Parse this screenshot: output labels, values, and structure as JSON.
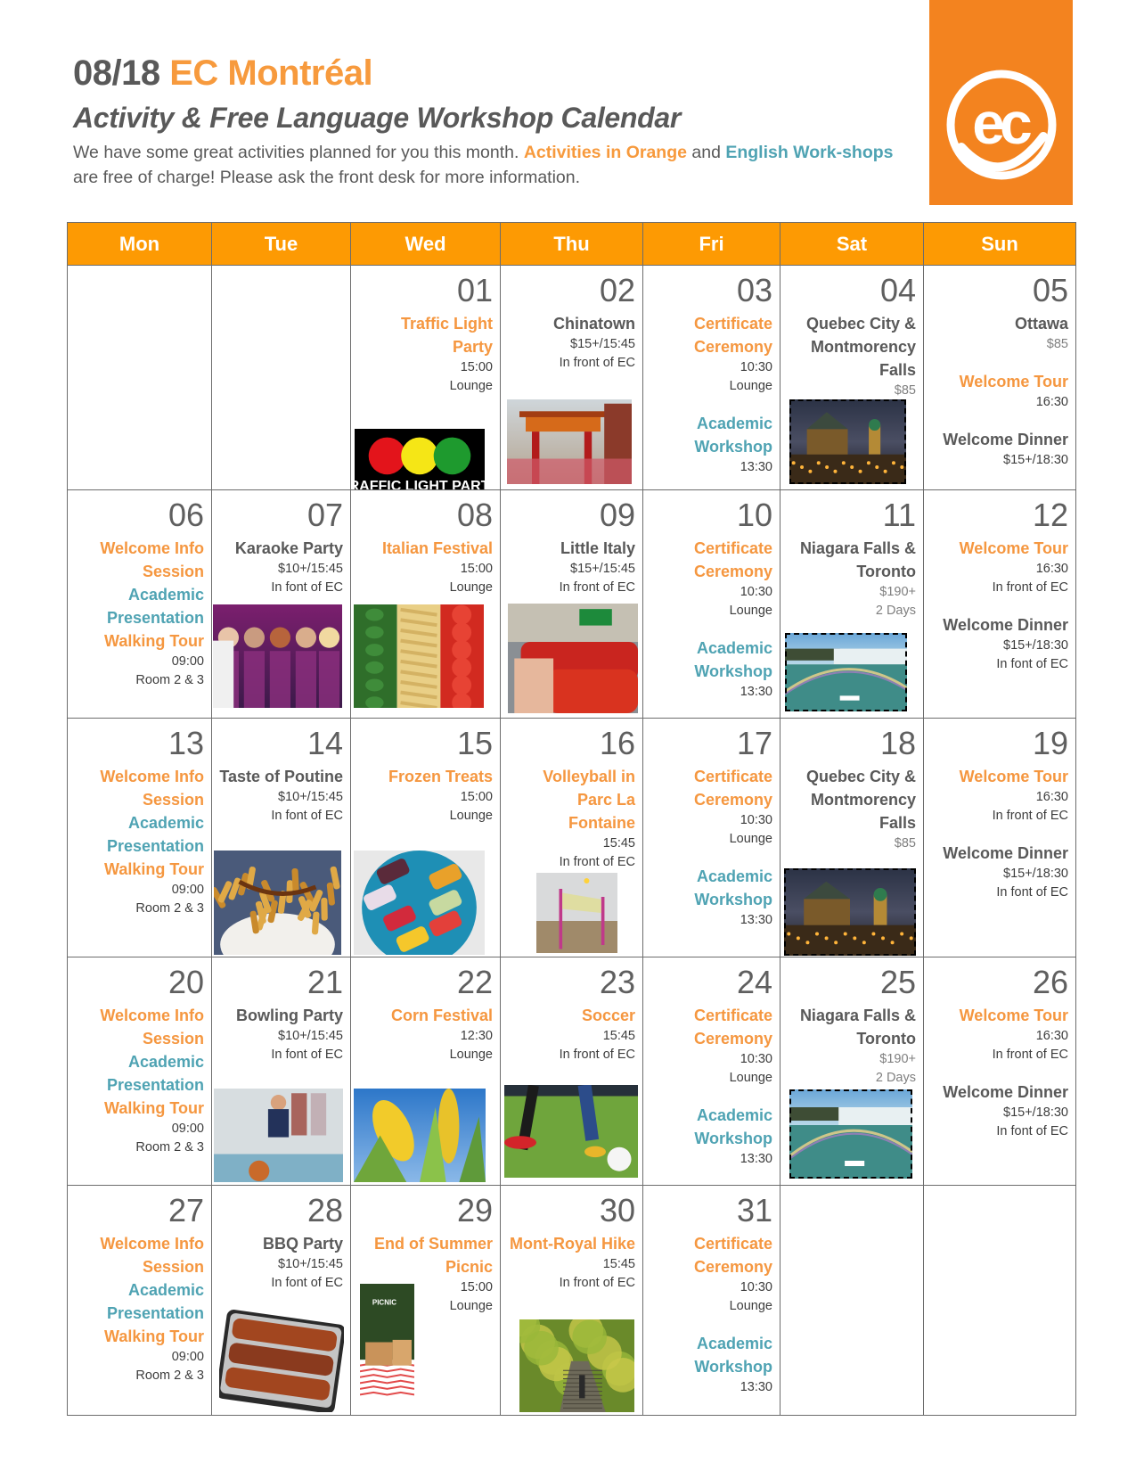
{
  "header": {
    "month": "08/18",
    "school": "EC Montréal",
    "subtitle": "Activity & Free Language Workshop Calendar",
    "intro_part1": "We have some great activities planned for you this month. ",
    "intro_orange": "Activities in Orange",
    "intro_and": " and ",
    "intro_teal": "English Work-shops",
    "intro_part2": " are free  of charge!  Please ask the front desk for more information."
  },
  "logo": {
    "text": "ec",
    "background": "#f3831f"
  },
  "colors": {
    "orange": "#f59740",
    "teal": "#4fa3b3",
    "header": "#fd9a03",
    "gray": "#595959"
  },
  "weekdays": [
    "Mon",
    "Tue",
    "Wed",
    "Thu",
    "Fri",
    "Sat",
    "Sun"
  ],
  "weeks": [
    [
      {
        "day": ""
      },
      {
        "day": ""
      },
      {
        "day": "01",
        "events": [
          {
            "title": "Traffic Light Party",
            "color": "orange",
            "details": [
              "15:00",
              "Lounge"
            ]
          }
        ],
        "image": "traffic-light-party"
      },
      {
        "day": "02",
        "events": [
          {
            "title": "Chinatown",
            "color": "gray",
            "details": [
              "$15+/15:45",
              "In front of EC"
            ]
          }
        ],
        "image": "chinatown-gate"
      },
      {
        "day": "03",
        "events": [
          {
            "title": "Certificate Ceremony",
            "color": "orange",
            "details": [
              "10:30",
              "Lounge"
            ]
          },
          {
            "title": "Academic Workshop",
            "color": "teal",
            "details": [
              "13:30"
            ]
          }
        ]
      },
      {
        "day": "04",
        "events": [
          {
            "title": "Quebec City & Montmorency Falls",
            "color": "gray",
            "details": [
              "$85"
            ]
          }
        ],
        "image": "quebec-city-night"
      },
      {
        "day": "05",
        "events": [
          {
            "title": "Ottawa",
            "color": "gray",
            "details": [
              "$85"
            ]
          },
          {
            "title": "Welcome Tour",
            "color": "orange",
            "details": [
              "16:30"
            ]
          },
          {
            "title": "Welcome Dinner",
            "color": "gray",
            "details": [
              "$15+/18:30"
            ]
          }
        ]
      }
    ],
    [
      {
        "day": "06",
        "events": [
          {
            "title": "Welcome Info Session",
            "color": "orange"
          },
          {
            "title": "Academic Presentation",
            "color": "teal"
          },
          {
            "title": "Walking Tour",
            "color": "orange",
            "details": [
              "09:00",
              "Room 2 & 3"
            ]
          }
        ]
      },
      {
        "day": "07",
        "events": [
          {
            "title": "Karaoke Party",
            "color": "gray",
            "details": [
              "$10+/15:45",
              "In font of EC"
            ]
          }
        ],
        "image": "karaoke-party"
      },
      {
        "day": "08",
        "events": [
          {
            "title": "Italian Festival",
            "color": "orange",
            "details": [
              "15:00",
              "Lounge"
            ]
          }
        ],
        "image": "italian-flag-food"
      },
      {
        "day": "09",
        "events": [
          {
            "title": "Little Italy",
            "color": "gray",
            "details": [
              "$15+/15:45",
              "In front of EC"
            ]
          }
        ],
        "image": "little-italy-cars"
      },
      {
        "day": "10",
        "events": [
          {
            "title": "Certificate Ceremony",
            "color": "orange",
            "details": [
              "10:30",
              "Lounge"
            ]
          },
          {
            "title": "Academic Workshop",
            "color": "teal",
            "details": [
              "13:30"
            ]
          }
        ]
      },
      {
        "day": "11",
        "events": [
          {
            "title": "Niagara Falls & Toronto",
            "color": "gray",
            "details": [
              "$190+",
              "2 Days"
            ]
          }
        ],
        "image": "niagara-falls"
      },
      {
        "day": "12",
        "events": [
          {
            "title": "Welcome Tour",
            "color": "orange",
            "details": [
              "16:30",
              "In front of EC"
            ]
          },
          {
            "title": "Welcome Dinner",
            "color": "gray",
            "details": [
              "$15+/18:30",
              "In font of EC"
            ]
          }
        ]
      }
    ],
    [
      {
        "day": "13",
        "events": [
          {
            "title": "Welcome Info Session",
            "color": "orange"
          },
          {
            "title": "Academic Presentation",
            "color": "teal"
          },
          {
            "title": "Walking Tour",
            "color": "orange",
            "details": [
              "09:00",
              "Room 2 & 3"
            ]
          }
        ]
      },
      {
        "day": "14",
        "events": [
          {
            "title": "Taste of Poutine",
            "color": "gray",
            "details": [
              "$10+/15:45",
              "In font of EC"
            ]
          }
        ],
        "image": "poutine"
      },
      {
        "day": "15",
        "events": [
          {
            "title": "Frozen Treats",
            "color": "orange",
            "details": [
              "15:00",
              "Lounge"
            ]
          }
        ],
        "image": "popsicles"
      },
      {
        "day": "16",
        "events": [
          {
            "title": "Volleyball in Parc La Fontaine",
            "color": "orange",
            "details": [
              "15:45",
              "In front of EC"
            ]
          }
        ],
        "image": "beach-volleyball"
      },
      {
        "day": "17",
        "events": [
          {
            "title": "Certificate Ceremony",
            "color": "orange",
            "details": [
              "10:30",
              "Lounge"
            ]
          },
          {
            "title": "Academic Workshop",
            "color": "teal",
            "details": [
              "13:30"
            ]
          }
        ]
      },
      {
        "day": "18",
        "events": [
          {
            "title": "Quebec City & Montmorency Falls",
            "color": "gray",
            "details": [
              "$85"
            ]
          }
        ],
        "image": "quebec-city-night"
      },
      {
        "day": "19",
        "events": [
          {
            "title": "Welcome Tour",
            "color": "orange",
            "details": [
              "16:30",
              "In front of EC"
            ]
          },
          {
            "title": "Welcome Dinner",
            "color": "gray",
            "details": [
              "$15+/18:30",
              "In font of EC"
            ]
          }
        ]
      }
    ],
    [
      {
        "day": "20",
        "events": [
          {
            "title": "Welcome Info Session",
            "color": "orange"
          },
          {
            "title": "Academic Presentation",
            "color": "teal"
          },
          {
            "title": "Walking Tour",
            "color": "orange",
            "details": [
              "09:00",
              "Room 2 & 3"
            ]
          }
        ]
      },
      {
        "day": "21",
        "events": [
          {
            "title": "Bowling Party",
            "color": "gray",
            "details": [
              "$10+/15:45",
              "In font of EC"
            ]
          }
        ],
        "image": "bowling"
      },
      {
        "day": "22",
        "events": [
          {
            "title": "Corn Festival",
            "color": "orange",
            "details": [
              "12:30",
              "Lounge"
            ]
          }
        ],
        "image": "corn"
      },
      {
        "day": "23",
        "events": [
          {
            "title": "Soccer",
            "color": "orange",
            "details": [
              "15:45",
              "In front of EC"
            ]
          }
        ],
        "image": "soccer"
      },
      {
        "day": "24",
        "events": [
          {
            "title": "Certificate Ceremony",
            "color": "orange",
            "details": [
              "10:30",
              "Lounge"
            ]
          },
          {
            "title": "Academic Workshop",
            "color": "teal",
            "details": [
              "13:30"
            ]
          }
        ]
      },
      {
        "day": "25",
        "events": [
          {
            "title": "Niagara Falls & Toronto",
            "color": "gray",
            "details": [
              "$190+",
              "2 Days"
            ]
          }
        ],
        "image": "niagara-falls"
      },
      {
        "day": "26",
        "events": [
          {
            "title": "Welcome Tour",
            "color": "orange",
            "details": [
              "16:30",
              "In front of EC"
            ]
          },
          {
            "title": "Welcome Dinner",
            "color": "gray",
            "details": [
              "$15+/18:30",
              "In font of EC"
            ]
          }
        ]
      }
    ],
    [
      {
        "day": "27",
        "events": [
          {
            "title": "Welcome Info Session",
            "color": "orange"
          },
          {
            "title": "Academic Presentation",
            "color": "teal"
          },
          {
            "title": "Walking Tour",
            "color": "orange",
            "details": [
              "09:00",
              "Room 2 & 3"
            ]
          }
        ]
      },
      {
        "day": "28",
        "events": [
          {
            "title": "BBQ Party",
            "color": "gray",
            "details": [
              "$10+/15:45",
              "In font of EC"
            ]
          }
        ],
        "image": "bbq-ribs"
      },
      {
        "day": "29",
        "events": [
          {
            "title": "End of Summer Picnic",
            "color": "orange",
            "details": [
              "15:00",
              "Lounge"
            ]
          }
        ],
        "image": "picnic"
      },
      {
        "day": "30",
        "events": [
          {
            "title": "Mont-Royal Hike",
            "color": "orange",
            "details": [
              "15:45",
              "In front of EC"
            ]
          }
        ],
        "image": "mont-royal-stairs"
      },
      {
        "day": "31",
        "events": [
          {
            "title": "Certificate Ceremony",
            "color": "orange",
            "details": [
              "10:30",
              "Lounge"
            ]
          },
          {
            "title": "Academic Workshop",
            "color": "teal",
            "details": [
              "13:30"
            ]
          }
        ]
      },
      {
        "day": ""
      },
      {
        "day": ""
      }
    ]
  ],
  "image_labels": {
    "traffic-light-party": "TRAFFIC LIGHT PARTY",
    "picnic": "PICNIC"
  }
}
